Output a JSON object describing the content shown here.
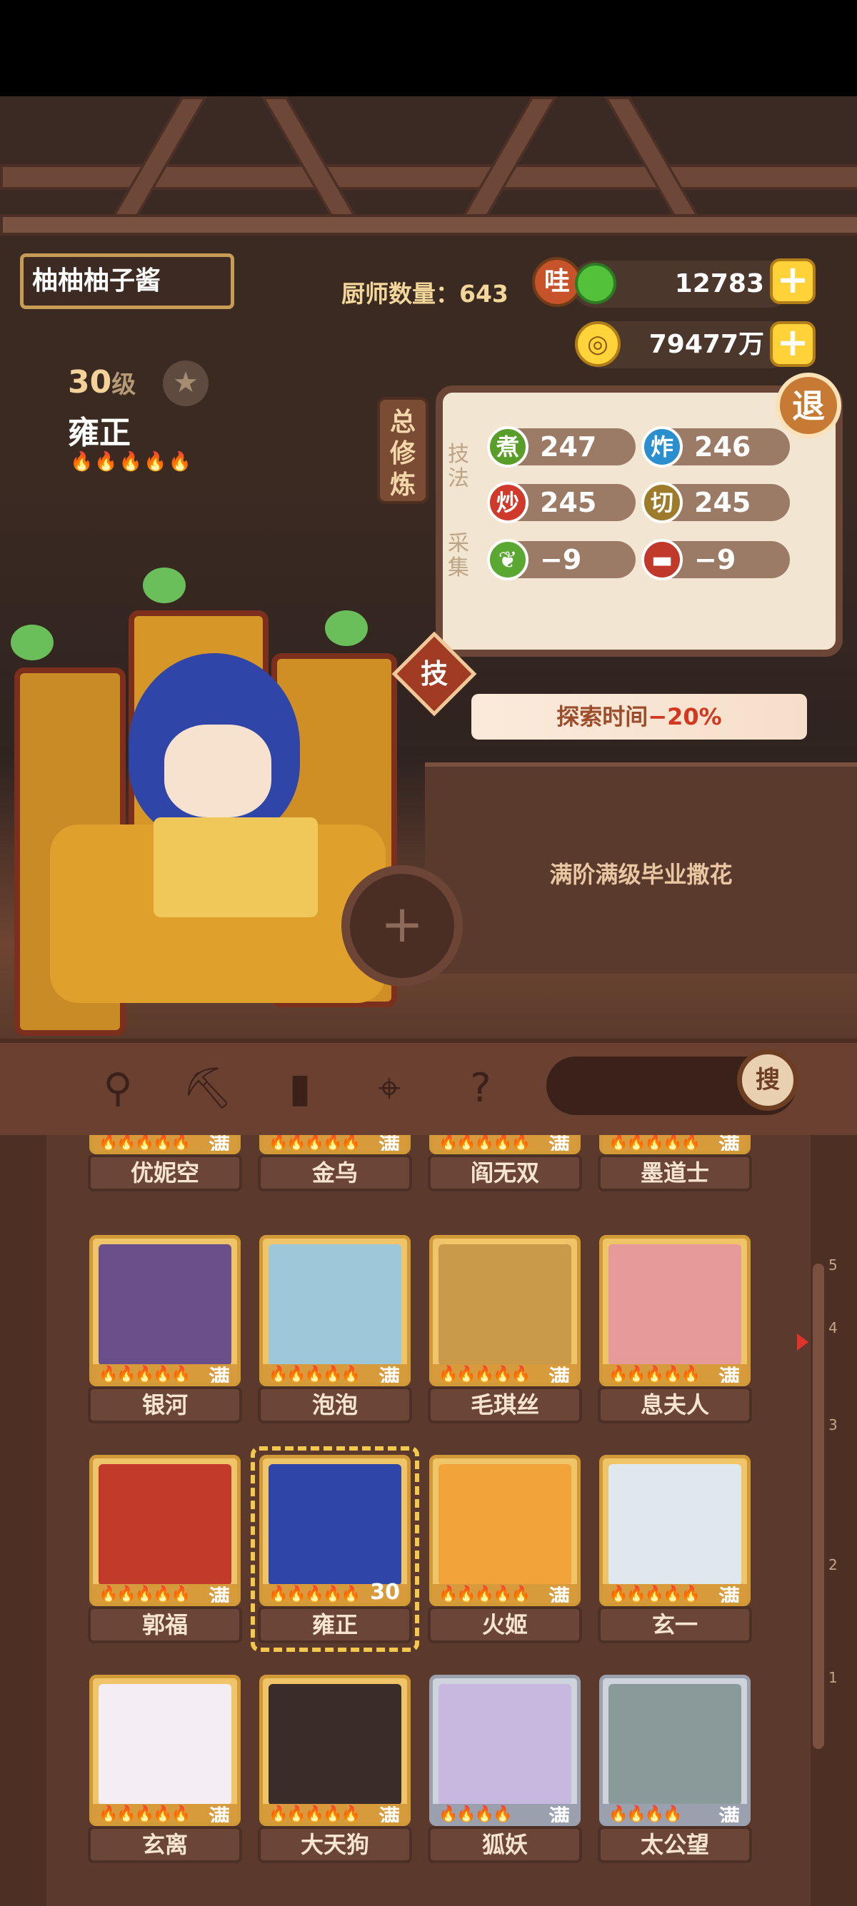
{
  "player": {
    "name": "柚柚柚子酱"
  },
  "chef_count": {
    "label": "厨师数量：",
    "value": "643"
  },
  "currency": [
    {
      "badge": "哇",
      "value": "12783",
      "icon": "jade-coin-icon"
    },
    {
      "badge": "",
      "value": "79477万",
      "icon": "gold-coin-icon"
    }
  ],
  "chef": {
    "level": "30",
    "level_unit": "级",
    "name": "雍正",
    "flames": "🔥🔥🔥🔥🔥"
  },
  "panel": {
    "side_tag": "总修炼",
    "exit_label": "退",
    "skill_label": "技法",
    "gather_label": "采集",
    "stats": [
      {
        "icon": "煮",
        "value": "247",
        "color": "#5a9e2a"
      },
      {
        "icon": "炸",
        "value": "246",
        "color": "#2b8fcf"
      },
      {
        "icon": "炒",
        "value": "245",
        "color": "#cf3a2a"
      },
      {
        "icon": "切",
        "value": "245",
        "color": "#9e7b2a"
      },
      {
        "icon": "veg-icon",
        "value": "−9",
        "color": "#5aa832"
      },
      {
        "icon": "meat-icon",
        "value": "−9",
        "color": "#c0392b"
      }
    ],
    "skill_badge": "技"
  },
  "ribbon": {
    "prefix": "探索时间",
    "value": "−20%"
  },
  "description": "满阶满级毕业撒花",
  "search": {
    "button_label": "搜"
  },
  "toolbar": [
    "shovel-icon",
    "pickaxe-icon",
    "jar-icon",
    "location-icon",
    "book-icon"
  ],
  "chef_rows": [
    [
      {
        "name": "优妮空",
        "tag": "满"
      },
      {
        "name": "金乌",
        "tag": "满"
      },
      {
        "name": "阎无双",
        "tag": "满"
      },
      {
        "name": "墨道士",
        "tag": "满"
      }
    ],
    [
      {
        "name": "银河",
        "tag": "满"
      },
      {
        "name": "泡泡",
        "tag": "满"
      },
      {
        "name": "毛琪丝",
        "tag": "满"
      },
      {
        "name": "息夫人",
        "tag": "满"
      }
    ],
    [
      {
        "name": "郭福",
        "tag": "满"
      },
      {
        "name": "雍正",
        "tag": "30"
      },
      {
        "name": "火姬",
        "tag": "满"
      },
      {
        "name": "玄一",
        "tag": "满"
      }
    ],
    [
      {
        "name": "玄离",
        "tag": "满"
      },
      {
        "name": "大天狗",
        "tag": "满"
      },
      {
        "name": "狐妖",
        "tag": "满"
      },
      {
        "name": "太公望",
        "tag": "满"
      }
    ]
  ],
  "scroll_ticks": [
    "5",
    "4",
    "3",
    "2",
    "1"
  ]
}
